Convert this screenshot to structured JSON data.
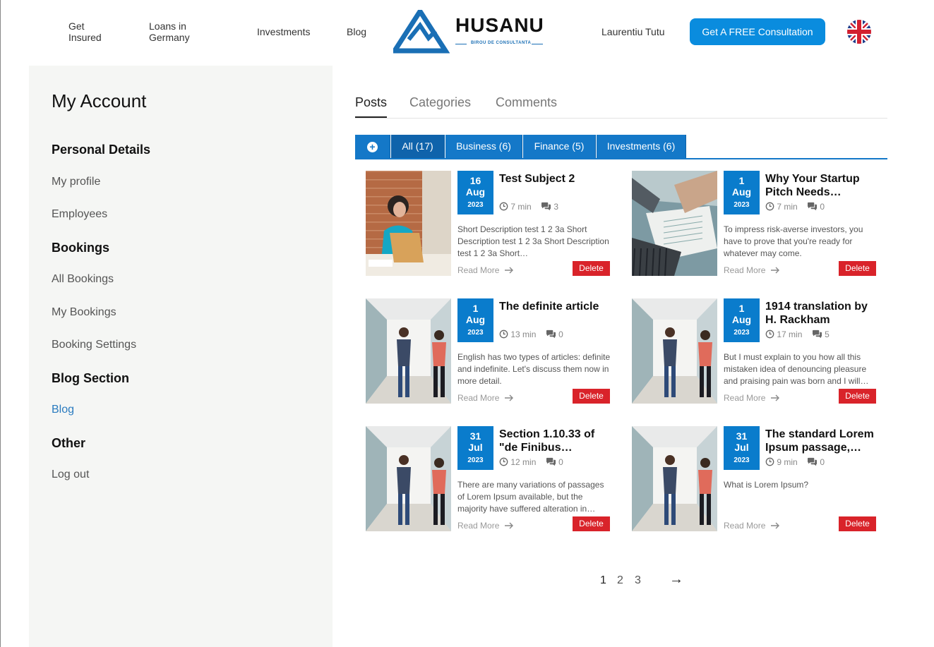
{
  "header": {
    "nav": [
      "Get Insured",
      "Loans in Germany",
      "Investments",
      "Blog"
    ],
    "logo_text": "HUSANU",
    "logo_subtext": "BIROU DE CONSULTANTA",
    "user_name": "Laurentiu Tutu",
    "cta_label": "Get A FREE Consultation",
    "language_flag": "uk-flag-icon"
  },
  "sidebar": {
    "title": "My Account",
    "sections": [
      {
        "heading": "Personal Details",
        "items": [
          "My profile",
          "Employees"
        ]
      },
      {
        "heading": "Bookings",
        "items": [
          "All Bookings",
          "My Bookings",
          "Booking Settings"
        ]
      },
      {
        "heading": "Blog Section",
        "items": [
          "Blog"
        ]
      },
      {
        "heading": "Other",
        "items": [
          "Log out"
        ]
      }
    ],
    "active_item": "Blog"
  },
  "main": {
    "tabs": [
      "Posts",
      "Categories",
      "Comments"
    ],
    "active_tab": "Posts",
    "filters": [
      "All (17)",
      "Business (6)",
      "Finance (5)",
      "Investments (6)"
    ],
    "active_filter": "All (17)",
    "read_more_label": "Read More",
    "delete_label": "Delete",
    "posts": [
      {
        "day": "16",
        "month": "Aug",
        "year": "2023",
        "title": "Test Subject 2",
        "read_time": "7 min",
        "comments": "3",
        "description": "Short Description test 1 2 3a Short Description test 1 2 3a Short Description test 1 2 3a Short…",
        "image": "office-woman-laptop"
      },
      {
        "day": "1",
        "month": "Aug",
        "year": "2023",
        "title": "Why Your Startup Pitch Needs…",
        "read_time": "7 min",
        "comments": "0",
        "description": "To impress risk-averse investors, you have to prove that you're ready for whatever may come.",
        "image": "laptop-documents"
      },
      {
        "day": "1",
        "month": "Aug",
        "year": "2023",
        "title": "The definite article",
        "read_time": "13 min",
        "comments": "0",
        "description": "English has two types of articles: definite and indefinite. Let's discuss them now in more detail.",
        "image": "women-hallway"
      },
      {
        "day": "1",
        "month": "Aug",
        "year": "2023",
        "title": "1914 translation by H. Rackham",
        "read_time": "17 min",
        "comments": "5",
        "description": "But I must explain to you how all this mistaken idea of denouncing pleasure and praising pain was born and I will…",
        "image": "women-hallway"
      },
      {
        "day": "31",
        "month": "Jul",
        "year": "2023",
        "title": "Section 1.10.33 of \"de Finibus…",
        "read_time": "12 min",
        "comments": "0",
        "description": "There are many variations of passages of Lorem Ipsum available, but the majority have suffered alteration in…",
        "image": "women-hallway"
      },
      {
        "day": "31",
        "month": "Jul",
        "year": "2023",
        "title": "The standard Lorem Ipsum passage,…",
        "read_time": "9 min",
        "comments": "0",
        "description": "What is Lorem Ipsum?",
        "image": "women-hallway"
      }
    ]
  },
  "pagination": {
    "pages": [
      "1",
      "2",
      "3"
    ],
    "current": "1",
    "next_label": "→"
  },
  "colors": {
    "primary": "#0a8cde",
    "filter_bar": "#1478c8",
    "date_box": "#0a7ccc",
    "delete": "#d9232a",
    "sidebar_bg": "#f5f6f4",
    "active_link": "#2a7bbf"
  }
}
